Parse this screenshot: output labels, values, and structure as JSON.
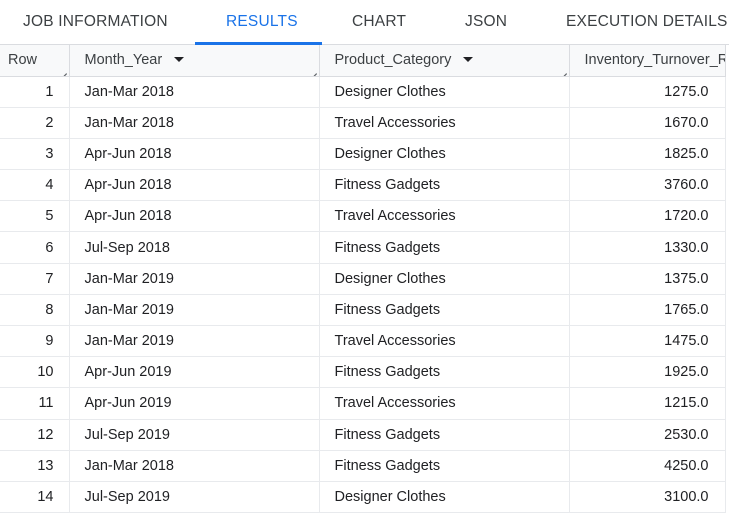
{
  "tabs": [
    {
      "label": "JOB INFORMATION",
      "active": false
    },
    {
      "label": "RESULTS",
      "active": true
    },
    {
      "label": "CHART",
      "active": false
    },
    {
      "label": "JSON",
      "active": false
    },
    {
      "label": "EXECUTION DETAILS",
      "active": false
    }
  ],
  "colors": {
    "accent": "#1a73e8",
    "header_bg": "#f8f9fa",
    "border": "#dadce0"
  },
  "columns": {
    "row": "Row",
    "month_year": "Month_Year",
    "product_category": "Product_Category",
    "inventory_turnover": "Inventory_Turnover_R"
  },
  "rows": [
    {
      "row": "1",
      "month_year": "Jan-Mar 2018",
      "product_category": "Designer Clothes",
      "value": "1275.0"
    },
    {
      "row": "2",
      "month_year": "Jan-Mar 2018",
      "product_category": "Travel Accessories",
      "value": "1670.0"
    },
    {
      "row": "3",
      "month_year": "Apr-Jun 2018",
      "product_category": "Designer Clothes",
      "value": "1825.0"
    },
    {
      "row": "4",
      "month_year": "Apr-Jun 2018",
      "product_category": "Fitness Gadgets",
      "value": "3760.0"
    },
    {
      "row": "5",
      "month_year": "Apr-Jun 2018",
      "product_category": "Travel Accessories",
      "value": "1720.0"
    },
    {
      "row": "6",
      "month_year": "Jul-Sep 2018",
      "product_category": "Fitness Gadgets",
      "value": "1330.0"
    },
    {
      "row": "7",
      "month_year": "Jan-Mar 2019",
      "product_category": "Designer Clothes",
      "value": "1375.0"
    },
    {
      "row": "8",
      "month_year": "Jan-Mar 2019",
      "product_category": "Fitness Gadgets",
      "value": "1765.0"
    },
    {
      "row": "9",
      "month_year": "Jan-Mar 2019",
      "product_category": "Travel Accessories",
      "value": "1475.0"
    },
    {
      "row": "10",
      "month_year": "Apr-Jun 2019",
      "product_category": "Fitness Gadgets",
      "value": "1925.0"
    },
    {
      "row": "11",
      "month_year": "Apr-Jun 2019",
      "product_category": "Travel Accessories",
      "value": "1215.0"
    },
    {
      "row": "12",
      "month_year": "Jul-Sep 2019",
      "product_category": "Fitness Gadgets",
      "value": "2530.0"
    },
    {
      "row": "13",
      "month_year": "Jan-Mar 2018",
      "product_category": "Fitness Gadgets",
      "value": "4250.0"
    },
    {
      "row": "14",
      "month_year": "Jul-Sep 2019",
      "product_category": "Designer Clothes",
      "value": "3100.0"
    }
  ]
}
